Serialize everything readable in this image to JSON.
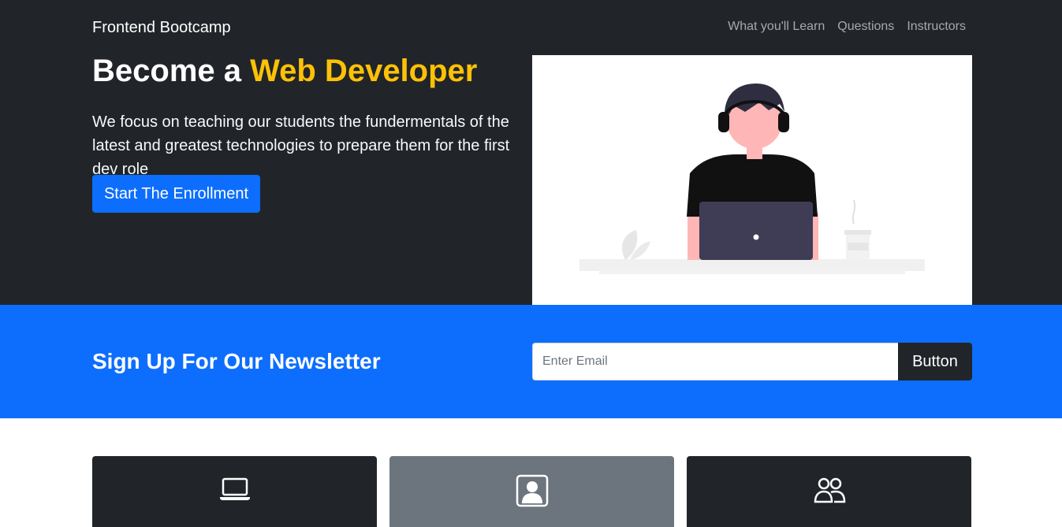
{
  "navbar": {
    "brand": "Frontend Bootcamp",
    "links": [
      "What you'll Learn",
      "Questions",
      "Instructors"
    ]
  },
  "hero": {
    "title_prefix": "Become a",
    "title_accent": "Web Developer",
    "lead": "We focus on teaching our students the fundermentals of the latest and greatest technologies to prepare them for the first dev role",
    "cta_label": "Start The Enrollment",
    "illustration": "person-with-headphones-at-laptop"
  },
  "newsletter": {
    "title": "Sign Up For Our Newsletter",
    "email_value": "",
    "email_placeholder": "Enter Email",
    "button_label": "Button"
  },
  "cards": [
    {
      "icon": "laptop-icon",
      "theme": "dark"
    },
    {
      "icon": "person-badge-icon",
      "theme": "gray"
    },
    {
      "icon": "people-icon",
      "theme": "dark"
    }
  ],
  "colors": {
    "dark": "#212529",
    "primary": "#0d6efd",
    "accent": "#ffc107",
    "secondary": "#6c757d"
  }
}
